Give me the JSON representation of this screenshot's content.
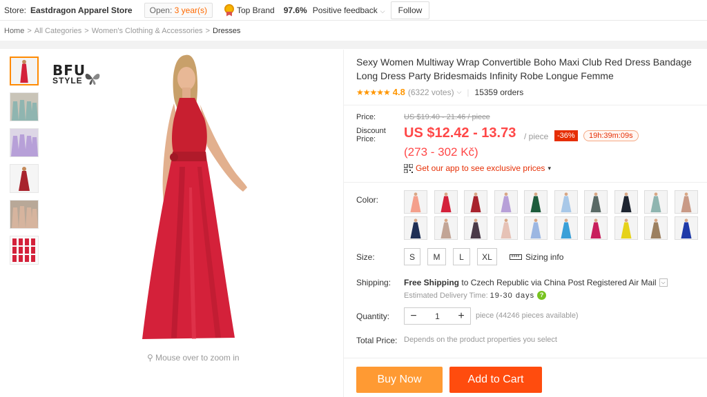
{
  "store": {
    "label": "Store:",
    "name": "Eastdragon Apparel Store",
    "open_prefix": "Open:",
    "open_years": "3 year(s)",
    "top_brand": "Top Brand",
    "feedback_pct": "97.6%",
    "feedback_label": "Positive feedback",
    "follow_label": "Follow"
  },
  "breadcrumb": {
    "items": [
      "Home",
      "All Categories",
      "Women's Clothing & Accessories",
      "Dresses"
    ],
    "separator": ">"
  },
  "gallery": {
    "brand_line1": "BFU",
    "brand_line2": "STYLE",
    "zoom_hint": "Mouse over to zoom in",
    "thumbnail_count": 6,
    "selected_thumbnail": 1
  },
  "product": {
    "title": "Sexy Women Multiway Wrap Convertible Boho Maxi Club Red Dress Bandage Long Dress Party Bridesmaids Infinity Robe Longue Femme",
    "stars": "★★★★★",
    "rating": "4.8",
    "votes": "(6322 votes)",
    "orders": "15359 orders"
  },
  "price": {
    "label": "Price:",
    "old": "US $19.40 - 21.46 / piece",
    "discount_label_1": "Discount",
    "discount_label_2": "Price:",
    "new": "US $12.42 - 13.73",
    "per_piece": "/ piece",
    "discount_pct": "-36%",
    "timer": "19h:39m:09s",
    "czk": "(273 - 302 Kč)",
    "app_promo": "Get our app to see exclusive prices"
  },
  "options": {
    "color_label": "Color:",
    "colors": [
      "#f4a08c",
      "#d4213a",
      "#a8232d",
      "#b7a0d8",
      "#1d5c3c",
      "#a8c8e8",
      "#5a6a66",
      "#1d2430",
      "#8fb5b0",
      "#c99a86",
      "#1f2f55",
      "#c2a596",
      "#4a3a48",
      "#e6c2b6",
      "#9cb7e2",
      "#3aa0d8",
      "#c81f5c",
      "#e6d21a",
      "#9c8060",
      "#1f3aa8"
    ],
    "size_label": "Size:",
    "sizes": [
      "S",
      "M",
      "L",
      "XL"
    ],
    "sizing_info": "Sizing info"
  },
  "shipping": {
    "label": "Shipping:",
    "free": "Free Shipping",
    "to": "to",
    "country": "Czech Republic",
    "via": "via",
    "carrier": "China Post Registered Air Mail",
    "delivery_label": "Estimated Delivery Time:",
    "delivery_days": "19-30 days"
  },
  "quantity": {
    "label": "Quantity:",
    "value": "1",
    "note": "piece (44246 pieces available)"
  },
  "total": {
    "label": "Total Price:",
    "note": "Depends on the product properties you select"
  },
  "actions": {
    "buy_now": "Buy Now",
    "add_to_cart": "Add to Cart"
  },
  "colors": {
    "accent_orange": "#ff6a00",
    "price_red": "#ff4747",
    "buy_now": "#ff9a33",
    "add_to_cart": "#ff4c0e",
    "dress_red": "#d4213a"
  }
}
